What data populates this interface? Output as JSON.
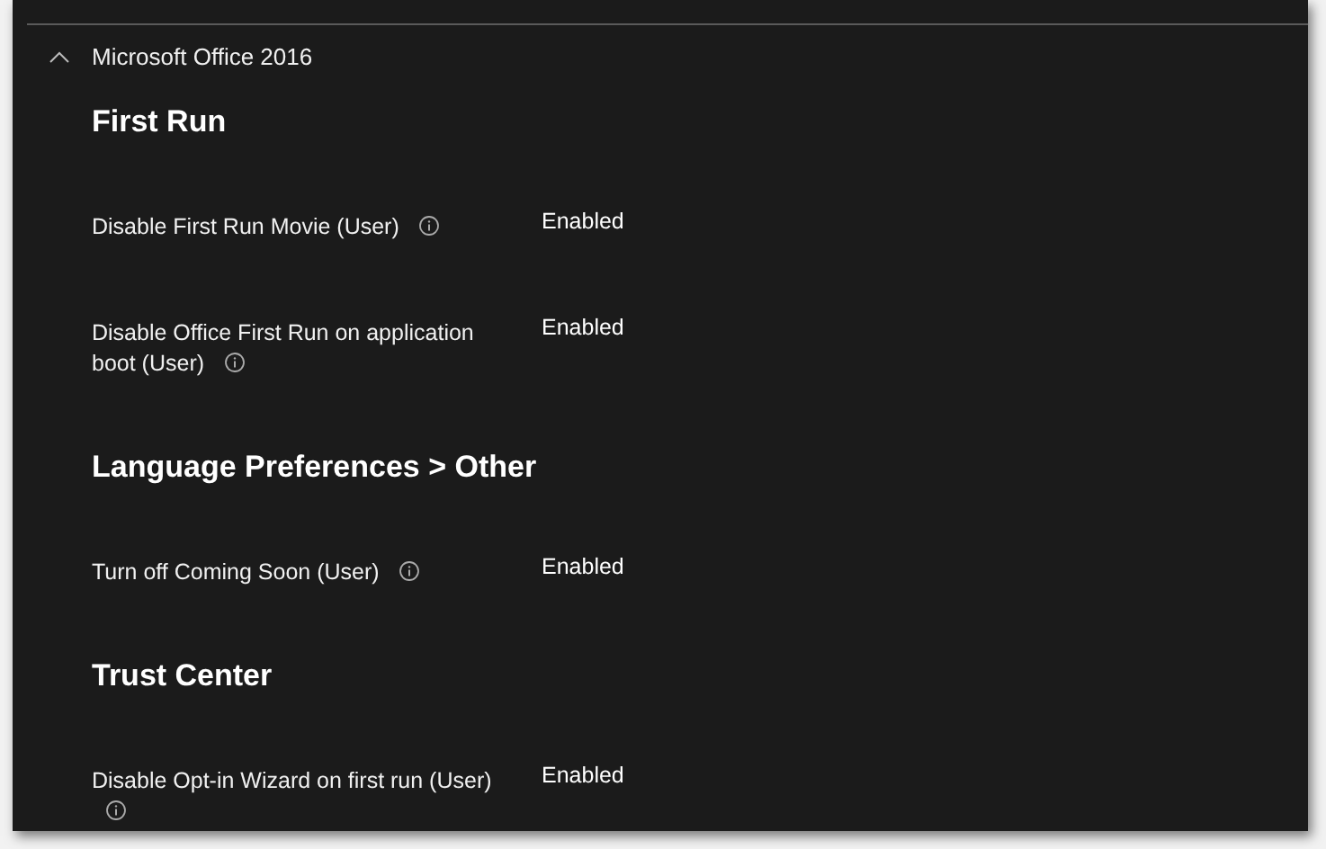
{
  "group": {
    "title": "Microsoft Office 2016",
    "expanded": true
  },
  "sections": [
    {
      "heading": "First Run",
      "settings": [
        {
          "label": "Disable First Run Movie (User)",
          "value": "Enabled"
        },
        {
          "label": "Disable Office First Run on application boot (User)",
          "value": "Enabled"
        }
      ]
    },
    {
      "heading": "Language Preferences > Other",
      "settings": [
        {
          "label": "Turn off Coming Soon (User)",
          "value": "Enabled"
        }
      ]
    },
    {
      "heading": "Trust Center",
      "settings": [
        {
          "label": "Disable Opt-in Wizard on first run (User)",
          "value": "Enabled"
        }
      ]
    }
  ]
}
